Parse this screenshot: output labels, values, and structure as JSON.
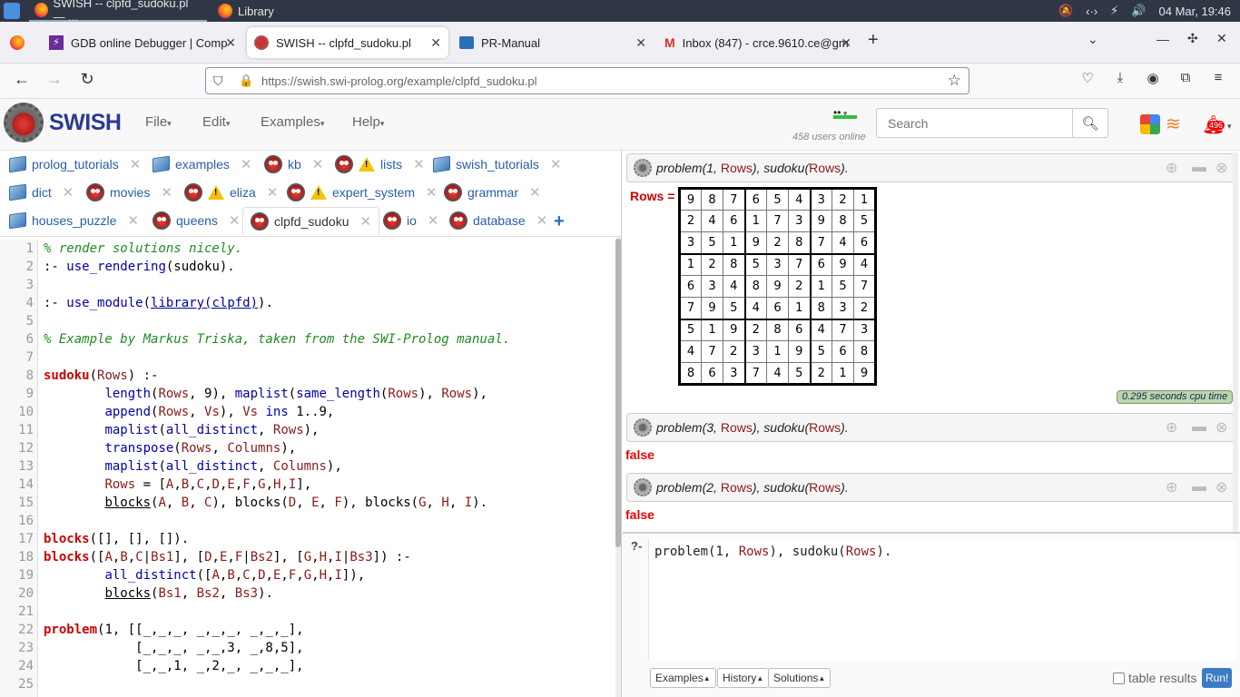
{
  "os": {
    "tasks": [
      {
        "label": "SWISH -- clpfd_sudoku.pl — ..."
      },
      {
        "label": "Library"
      }
    ],
    "clock": "04 Mar, 19:46"
  },
  "browser": {
    "tabs": [
      {
        "label": "GDB online Debugger | Comp"
      },
      {
        "label": "SWISH -- clpfd_sudoku.pl"
      },
      {
        "label": "PR-Manual"
      },
      {
        "label": "Inbox (847) - crce.9610.ce@gm"
      }
    ],
    "url": "https://swish.swi-prolog.org/example/clpfd_sudoku.pl"
  },
  "swish": {
    "logo": "SWISH",
    "menus": [
      "File",
      "Edit",
      "Examples",
      "Help"
    ],
    "users_online": "458 users online",
    "search_placeholder": "Search",
    "notification_count": "496"
  },
  "file_tabs": [
    {
      "label": "prolog_tutorials",
      "icon": "book-icon"
    },
    {
      "label": "examples",
      "icon": "book-icon"
    },
    {
      "label": "kb",
      "icon": "owl-icon"
    },
    {
      "label": "lists",
      "icon": "owl-warning-icon"
    },
    {
      "label": "swish_tutorials",
      "icon": "book-icon"
    },
    {
      "label": "dict",
      "icon": "book-icon"
    },
    {
      "label": "movies",
      "icon": "owl-icon"
    },
    {
      "label": "eliza",
      "icon": "owl-warning-icon"
    },
    {
      "label": "expert_system",
      "icon": "owl-warning-icon"
    },
    {
      "label": "grammar",
      "icon": "owl-icon"
    },
    {
      "label": "houses_puzzle",
      "icon": "book-icon"
    },
    {
      "label": "queens",
      "icon": "owl-icon"
    },
    {
      "label": "clpfd_sudoku",
      "icon": "owl-icon"
    },
    {
      "label": "io",
      "icon": "owl-icon"
    },
    {
      "label": "database",
      "icon": "owl-icon"
    }
  ],
  "code_lines": [
    "% render solutions nicely.",
    ":- use_rendering(sudoku).",
    "",
    ":- use_module(library(clpfd)).",
    "",
    "% Example by Markus Triska, taken from the SWI-Prolog manual.",
    "",
    "sudoku(Rows) :-",
    "        length(Rows, 9), maplist(same_length(Rows), Rows),",
    "        append(Rows, Vs), Vs ins 1..9,",
    "        maplist(all_distinct, Rows),",
    "        transpose(Rows, Columns),",
    "        maplist(all_distinct, Columns),",
    "        Rows = [A,B,C,D,E,F,G,H,I],",
    "        blocks(A, B, C), blocks(D, E, F), blocks(G, H, I).",
    "",
    "blocks([], [], []).",
    "blocks([A,B,C|Bs1], [D,E,F|Bs2], [G,H,I|Bs3]) :-",
    "        all_distinct([A,B,C,D,E,F,G,H,I]),",
    "        blocks(Bs1, Bs2, Bs3).",
    "",
    "problem(1, [[_,_,_, _,_,_, _,_,_],",
    "            [_,_,_, _,_,3, _,8,5],",
    "            [_,_,1, _,2,_, _,_,_],",
    ""
  ],
  "results": {
    "q1": {
      "pred": "problem",
      "args1": "(1, ",
      "var": "Rows",
      "sep": "), ",
      "pred2": "sudoku",
      "open": "(",
      "close": ")."
    },
    "rows_label": "Rows =",
    "grid": [
      [
        9,
        8,
        7,
        6,
        5,
        4,
        3,
        2,
        1
      ],
      [
        2,
        4,
        6,
        1,
        7,
        3,
        9,
        8,
        5
      ],
      [
        3,
        5,
        1,
        9,
        2,
        8,
        7,
        4,
        6
      ],
      [
        1,
        2,
        8,
        5,
        3,
        7,
        6,
        9,
        4
      ],
      [
        6,
        3,
        4,
        8,
        9,
        2,
        1,
        5,
        7
      ],
      [
        7,
        9,
        5,
        4,
        6,
        1,
        8,
        3,
        2
      ],
      [
        5,
        1,
        9,
        2,
        8,
        6,
        4,
        7,
        3
      ],
      [
        4,
        7,
        2,
        3,
        1,
        9,
        5,
        6,
        8
      ],
      [
        8,
        6,
        3,
        7,
        4,
        5,
        2,
        1,
        9
      ]
    ],
    "cpu_time": "0.295 seconds cpu time",
    "q3": {
      "pred": "problem",
      "args1": "(3, ",
      "var": "Rows",
      "sep": "), ",
      "pred2": "sudoku",
      "open": "(",
      "close": ")."
    },
    "q2": {
      "pred": "problem",
      "args1": "(2, ",
      "var": "Rows",
      "sep": "), ",
      "pred2": "sudoku",
      "open": "(",
      "close": ")."
    },
    "false_label": "false"
  },
  "query": {
    "prompt": "?-",
    "text_a": "problem(1, ",
    "text_var": "Rows",
    "text_b": "), sudoku(",
    "text_c": ").",
    "buttons": [
      "Examples",
      "History",
      "Solutions"
    ],
    "table_results": "table results",
    "run": "Run!"
  }
}
